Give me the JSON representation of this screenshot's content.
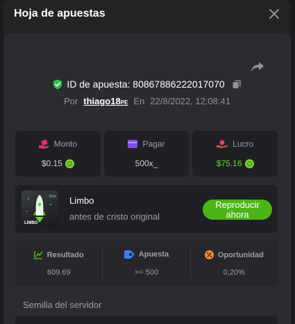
{
  "header": {
    "title": "Hoja de apuestas"
  },
  "bet": {
    "id_label": "ID de apuesta: 80867886222017070",
    "by_prefix": "Por",
    "username": "thiago18",
    "username_suffix": "PE",
    "on_prefix": "En",
    "datetime": "22/8/2022, 12:08:41"
  },
  "stats": [
    {
      "label": "Monto",
      "value": "$0.15",
      "icon": "money-hand-icon",
      "has_coin": true
    },
    {
      "label": "Pagar",
      "value": "500x_",
      "icon": "wallet-icon",
      "has_coin": false
    },
    {
      "label": "Lucro",
      "value": "$75.16",
      "icon": "profit-icon",
      "has_coin": true
    }
  ],
  "game": {
    "thumb_label": "LIMBO",
    "thumb_multiplier": "200x",
    "name": "Limbo",
    "subtitle": "antes de cristo original",
    "play_label": "Reproducir ahora"
  },
  "details": [
    {
      "label": "Resultado",
      "value": "609.69",
      "icon": "result-chart-icon"
    },
    {
      "label": "Apuesta",
      "value": ">= 500",
      "icon": "bet-tag-icon"
    },
    {
      "label": "Oportunidad",
      "value": "0,20%",
      "icon": "percent-icon"
    }
  ],
  "seed": {
    "label": "Semilla del servidor"
  },
  "colors": {
    "accent_green": "#4bb518",
    "profit_green": "#5fd92a",
    "pink": "#e0336a",
    "purple": "#7a4cf0",
    "red": "#e8424f",
    "blue": "#3d7bf0",
    "orange": "#f08c2d"
  }
}
